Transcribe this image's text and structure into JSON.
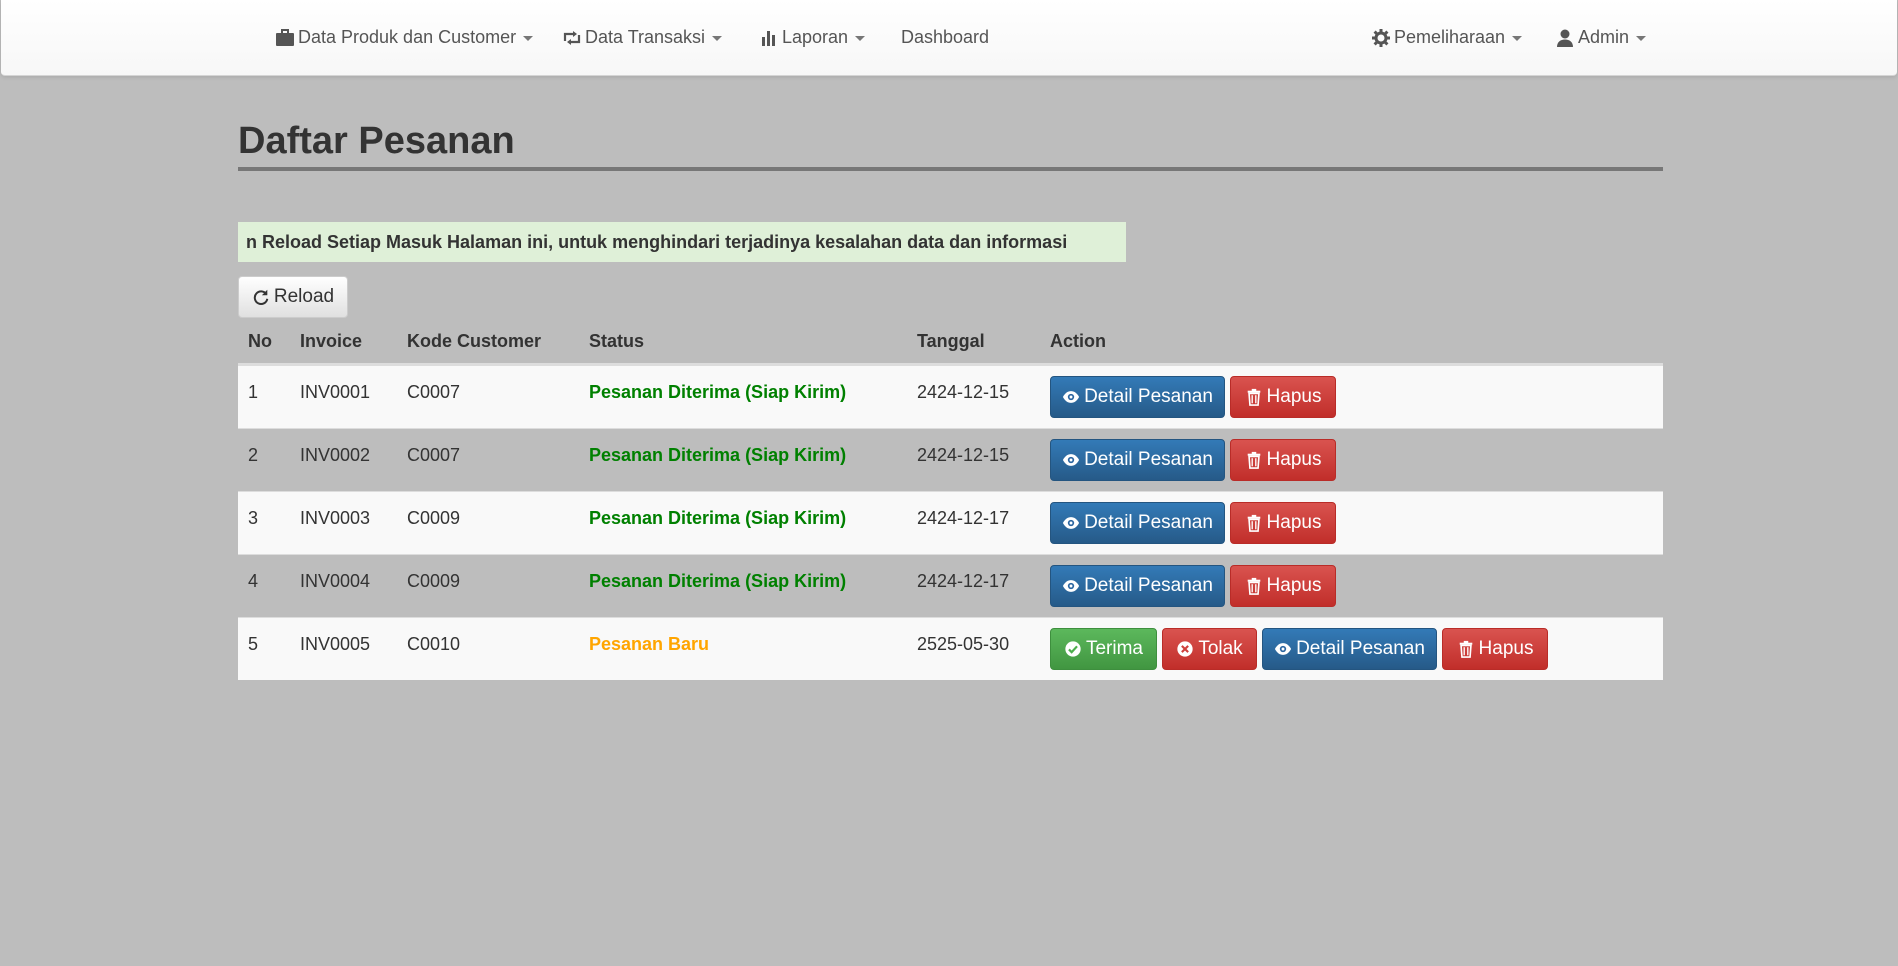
{
  "navbar": {
    "items": [
      {
        "label": "Data Produk dan Customer",
        "icon": "briefcase-icon"
      },
      {
        "label": "Data Transaksi",
        "icon": "retweet-icon"
      },
      {
        "label": "Laporan",
        "icon": "bar-chart-icon"
      },
      {
        "label": "Dashboard"
      }
    ],
    "right": [
      {
        "label": "Pemeliharaan",
        "icon": "gear-icon"
      },
      {
        "label": "Admin",
        "icon": "user-icon"
      }
    ]
  },
  "page": {
    "title": "Daftar Pesanan",
    "alert": "n Reload Setiap Masuk Halaman ini, untuk menghindari terjadinya kesalahan data dan informasi",
    "reload_label": "Reload"
  },
  "table": {
    "headers": {
      "no": "No",
      "invoice": "Invoice",
      "customer": "Kode Customer",
      "status": "Status",
      "date": "Tanggal",
      "action": "Action"
    },
    "rows": [
      {
        "no": "1",
        "invoice": "INV0001",
        "customer": "C0007",
        "status": "Pesanan Diterima (Siap Kirim)",
        "date": "2424-12-15"
      },
      {
        "no": "2",
        "invoice": "INV0002",
        "customer": "C0007",
        "status": "Pesanan Diterima (Siap Kirim)",
        "date": "2424-12-15"
      },
      {
        "no": "3",
        "invoice": "INV0003",
        "customer": "C0009",
        "status": "Pesanan Diterima (Siap Kirim)",
        "date": "2424-12-17"
      },
      {
        "no": "4",
        "invoice": "INV0004",
        "customer": "C0009",
        "status": "Pesanan Diterima (Siap Kirim)",
        "date": "2424-12-17"
      },
      {
        "no": "5",
        "invoice": "INV0005",
        "customer": "C0010",
        "status": "Pesanan Baru",
        "date": "2525-05-30"
      }
    ]
  },
  "actions": {
    "detail_label": "Detail Pesanan",
    "delete_label": "Hapus",
    "accept_label": "Terima",
    "reject_label": "Tolak"
  },
  "colors": {
    "status_accepted": "#008000",
    "status_new": "#ffa500",
    "primary": "#337ab7",
    "danger": "#d9534f",
    "success": "#5cb85c"
  }
}
